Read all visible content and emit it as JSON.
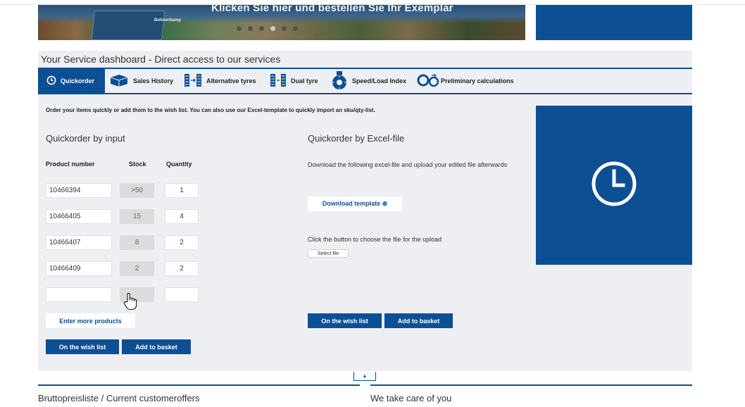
{
  "banner": {
    "headline": "Klicken Sie hier und bestellen Sie Ihr Exemplar",
    "box_label": "Bohnenkamp",
    "dots": [
      false,
      false,
      false,
      true,
      false,
      false
    ]
  },
  "dashboard": {
    "title": "Your Service dashboard - Direct access to our services",
    "tabs": [
      {
        "label": "Quickorder",
        "icon": "clock-icon",
        "active": true
      },
      {
        "label": "Sales History",
        "icon": "truck-icon",
        "active": false
      },
      {
        "label": "Alternative tyres",
        "icon": "tyre-swap-icon",
        "active": false
      },
      {
        "label": "Dual tyre",
        "icon": "dual-tyre-icon",
        "active": false
      },
      {
        "label": "Speed/Load Index",
        "icon": "speed-load-icon",
        "active": false
      },
      {
        "label": "Preliminary calculations",
        "icon": "calculation-icon",
        "active": false
      }
    ],
    "intro": "Order your items quickly or add them to the wish list. You can also use our Excel-template to quickly import an sku/qty-list."
  },
  "quick_input": {
    "heading": "Quickorder by input",
    "col_product": "Product number",
    "col_stock": "Stock",
    "col_qty": "Quantity",
    "rows": [
      {
        "product": "10466394",
        "stock": ">50",
        "qty": "1"
      },
      {
        "product": "10466405",
        "stock": "15",
        "qty": "4"
      },
      {
        "product": "10466407",
        "stock": "8",
        "qty": "2"
      },
      {
        "product": "10466409",
        "stock": "2",
        "qty": "2"
      },
      {
        "product": "",
        "stock": "",
        "qty": ""
      }
    ],
    "enter_more": "Enter more products",
    "wish_list": "On the wish list",
    "add_basket": "Add to basket"
  },
  "quick_excel": {
    "heading": "Quickorder by Excel-file",
    "download_text": "Download the following excel-file and upload your edited file afterwards",
    "download_btn": "Download template ⊕",
    "upload_text": "Click the button to choose the file for the upload",
    "select_file": "Select file",
    "wish_list": "On the wish list",
    "add_basket": "Add to basket"
  },
  "footer": {
    "left": "Bruttopreisliste / Current customeroffers",
    "right": "We take care of you",
    "toggle": "▲"
  },
  "colors": {
    "brand_blue": "#0d4f94",
    "panel_bg": "#eeeff3",
    "stock_bg": "#dcdcdc"
  }
}
